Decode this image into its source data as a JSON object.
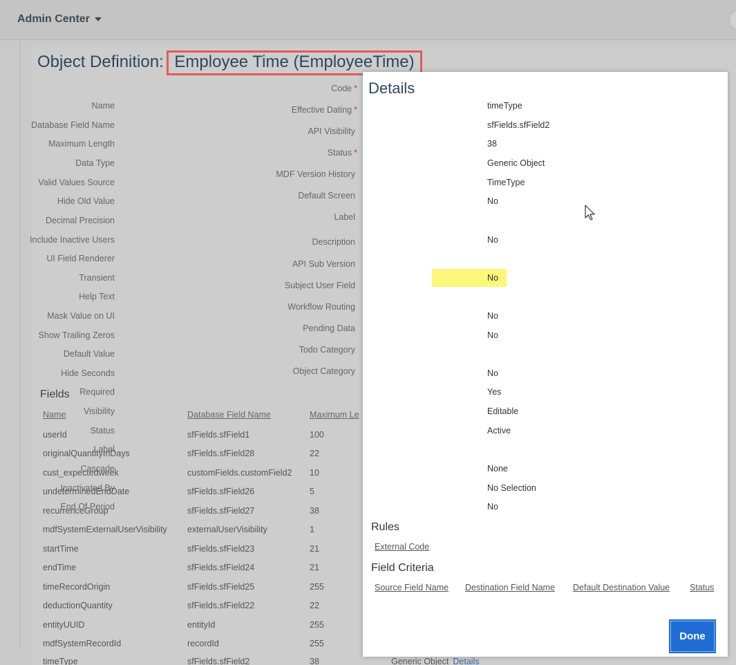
{
  "topbar": {
    "title": "Admin Center"
  },
  "object": {
    "title_prefix": "Object Definition: ",
    "title_name": "Employee Time (EmployeeTime)",
    "properties": [
      {
        "label": "Code",
        "required": "*"
      },
      {
        "label": "Effective Dating",
        "required": "*"
      },
      {
        "label": "API Visibility",
        "required": ""
      },
      {
        "label": "Status",
        "required": "*"
      },
      {
        "label": "MDF Version History",
        "required": ""
      },
      {
        "label": "Default Screen",
        "required": ""
      },
      {
        "label": "Label",
        "required": ""
      },
      {
        "label": "Description",
        "required": ""
      },
      {
        "label": "API Sub Version",
        "required": ""
      },
      {
        "label": "Subject User Field",
        "required": ""
      },
      {
        "label": "Workflow Routing",
        "required": ""
      },
      {
        "label": "Pending Data",
        "required": ""
      },
      {
        "label": "Todo Category",
        "required": ""
      },
      {
        "label": "Object Category",
        "required": ""
      }
    ]
  },
  "fields": {
    "heading": "Fields",
    "columns": [
      "Name",
      "Database Field Name",
      "Maximum Le"
    ],
    "rows": [
      [
        "userId",
        "sfFields.sfField1",
        "100"
      ],
      [
        "originalQuantityInDays",
        "sfFields.sfField28",
        "22"
      ],
      [
        "cust_expectedweek",
        "customFields.customField2",
        "10"
      ],
      [
        "undeterminedEndDate",
        "sfFields.sfField26",
        "5"
      ],
      [
        "recurrenceGroup",
        "sfFields.sfField27",
        "38"
      ],
      [
        "mdfSystemExternalUserVisibility",
        "externalUserVisibility",
        "1"
      ],
      [
        "startTime",
        "sfFields.sfField23",
        "21"
      ],
      [
        "endTime",
        "sfFields.sfField24",
        "21"
      ],
      [
        "timeRecordOrigin",
        "sfFields.sfField25",
        "255"
      ],
      [
        "deductionQuantity",
        "sfFields.sfField22",
        "22"
      ],
      [
        "entityUUID",
        "entityId",
        "255"
      ],
      [
        "mdfSystemRecordId",
        "recordId",
        "255"
      ],
      [
        "timeType",
        "sfFields.sfField2",
        "38"
      ]
    ],
    "last_row_type": "Generic Object",
    "last_row_link": "Details"
  },
  "details": {
    "title": "Details",
    "rows": [
      {
        "label": "Name",
        "value": "timeType"
      },
      {
        "label": "Database Field Name",
        "value": "sfFields.sfField2"
      },
      {
        "label": "Maximum Length",
        "value": "38"
      },
      {
        "label": "Data Type",
        "value": "Generic Object"
      },
      {
        "label": "Valid Values Source",
        "value": "TimeType"
      },
      {
        "label": "Hide Old Value",
        "value": "No"
      },
      {
        "label": "Decimal Precision",
        "value": ""
      },
      {
        "label": "Include Inactive Users",
        "value": "No"
      },
      {
        "label": "UI Field Renderer",
        "value": ""
      },
      {
        "label": "Transient",
        "value": "No"
      },
      {
        "label": "Help Text",
        "value": ""
      },
      {
        "label": "Mask Value on UI",
        "value": "No"
      },
      {
        "label": "Show Trailing Zeros",
        "value": "No"
      },
      {
        "label": "Default Value",
        "value": ""
      },
      {
        "label": "Hide Seconds",
        "value": "No"
      },
      {
        "label": "Required",
        "value": "Yes"
      },
      {
        "label": "Visibility",
        "value": "Editable"
      },
      {
        "label": "Status",
        "value": "Active"
      },
      {
        "label": "Label",
        "value": ""
      },
      {
        "label": "Cascade",
        "value": "None"
      },
      {
        "label": "Inactivated By",
        "value": "No Selection"
      },
      {
        "label": "End Of Period",
        "value": "No"
      }
    ],
    "rules_heading": "Rules",
    "rules_link": "External Code",
    "criteria_heading": "Field Criteria",
    "criteria_columns": [
      "Source Field Name",
      "Destination Field Name",
      "Default Destination Value",
      "Status"
    ],
    "done_label": "Done"
  },
  "colors": {
    "accent": "#1f6dd4",
    "title_highlight_border": "#e35a5a",
    "row_highlight": "#fdf77a"
  },
  "icons": {
    "topbar_menu": "chevron-down-icon",
    "mouse_cursor": "mouse-pointer-icon"
  }
}
